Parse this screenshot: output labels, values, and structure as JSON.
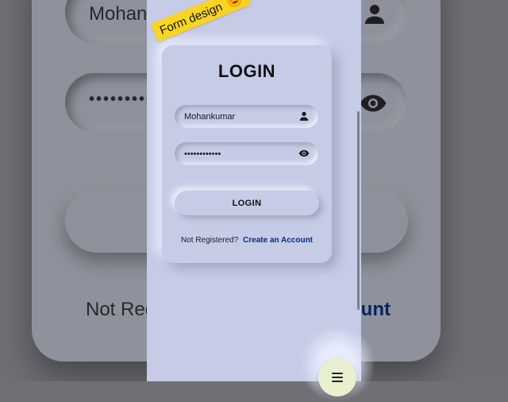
{
  "background": {
    "username_text": "Mohan",
    "password_text": "••••••••••",
    "not_registered_text": "Not Reg",
    "create_account_text": "ount"
  },
  "sticker": {
    "text": "Form design",
    "emoji_icon": "heart-eyes-emoji-icon"
  },
  "login_form": {
    "title": "LOGIN",
    "username": {
      "value": "Mohankumar",
      "icon": "user-icon"
    },
    "password": {
      "value": "••••••••••••",
      "icon": "eye-icon"
    },
    "login_button_label": "LOGIN",
    "not_registered_label": "Not Registered?",
    "create_account_link": "Create an Account"
  },
  "fab": {
    "icon": "menu-icon"
  },
  "colors": {
    "surface": "#c6cbe6",
    "link": "#0d2c7a",
    "sticker": "#f9d423",
    "fab": "#e8f0cf"
  }
}
